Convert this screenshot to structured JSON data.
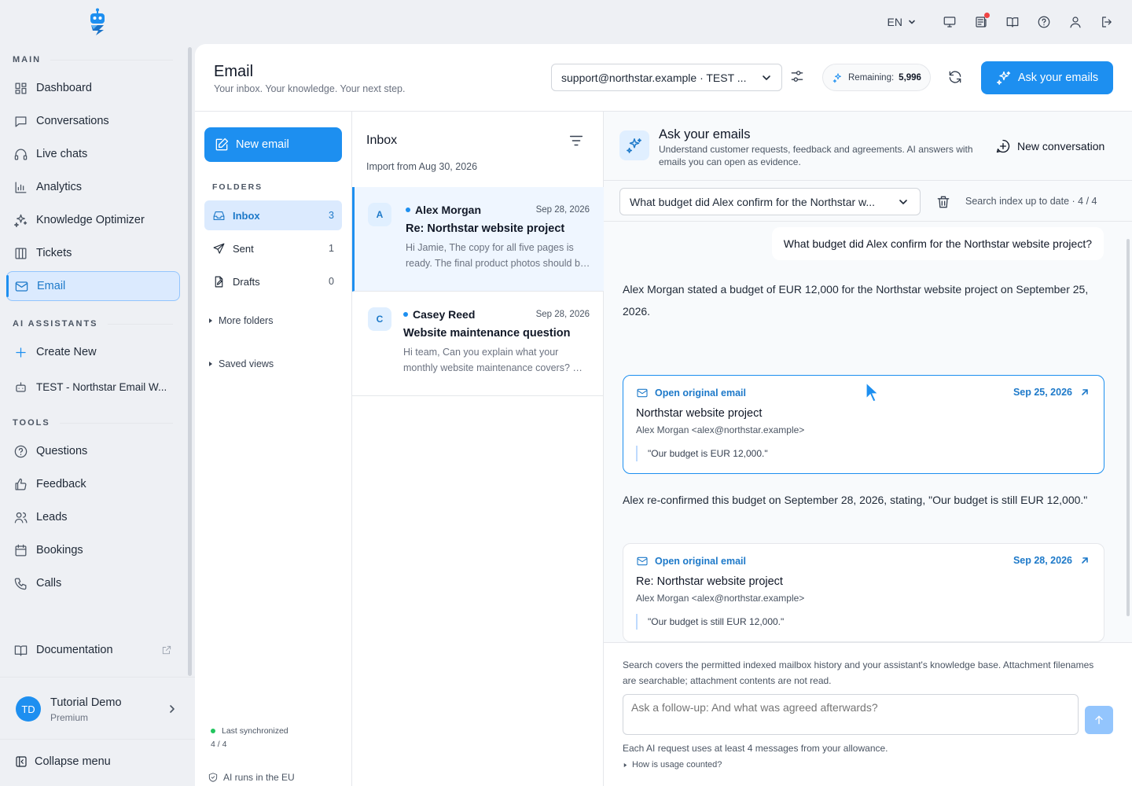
{
  "topbar": {
    "language": "EN",
    "icons": [
      "monitor-icon",
      "news-icon",
      "book-icon",
      "help-icon",
      "user-icon",
      "logout-icon"
    ]
  },
  "sidebar": {
    "sections": {
      "main": "MAIN",
      "ai": "AI ASSISTANTS",
      "tools": "TOOLS"
    },
    "main_items": [
      {
        "label": "Dashboard",
        "icon": "dashboard-icon"
      },
      {
        "label": "Conversations",
        "icon": "chat-icon"
      },
      {
        "label": "Live chats",
        "icon": "headset-icon"
      },
      {
        "label": "Analytics",
        "icon": "bar-chart-icon"
      },
      {
        "label": "Knowledge Optimizer",
        "icon": "sparkles-icon"
      },
      {
        "label": "Tickets",
        "icon": "columns-icon"
      },
      {
        "label": "Email",
        "icon": "mail-icon",
        "active": true
      }
    ],
    "ai_items": [
      {
        "label": "Create New",
        "icon": "plus-icon"
      },
      {
        "label": "TEST - Northstar Email W...",
        "icon": "bot-icon"
      }
    ],
    "tool_items": [
      {
        "label": "Questions",
        "icon": "question-icon"
      },
      {
        "label": "Feedback",
        "icon": "thumbs-up-icon"
      },
      {
        "label": "Leads",
        "icon": "users-icon"
      },
      {
        "label": "Bookings",
        "icon": "calendar-icon"
      },
      {
        "label": "Calls",
        "icon": "phone-icon"
      }
    ],
    "documentation": "Documentation",
    "profile": {
      "initials": "TD",
      "name": "Tutorial Demo",
      "plan": "Premium"
    },
    "collapse": "Collapse menu"
  },
  "header": {
    "title": "Email",
    "subtitle": "Your inbox. Your knowledge. Your next step.",
    "account": "support@northstar.example · TEST ...",
    "remaining_label": "Remaining:",
    "remaining_value": "5,996",
    "ask_button": "Ask your emails"
  },
  "folders": {
    "new_email": "New email",
    "label": "FOLDERS",
    "items": [
      {
        "label": "Inbox",
        "count": "3",
        "active": true
      },
      {
        "label": "Sent",
        "count": "1"
      },
      {
        "label": "Drafts",
        "count": "0"
      }
    ],
    "more": "More folders",
    "saved": "Saved views",
    "sync_label": "Last synchronized",
    "sync_count": "4 / 4",
    "eu": "AI runs in the EU"
  },
  "inbox": {
    "title": "Inbox",
    "import": "Import from Aug 30, 2026",
    "messages": [
      {
        "initial": "A",
        "from": "Alex Morgan",
        "date": "Sep 28, 2026",
        "subject": "Re: Northstar website project",
        "snippet": "Hi Jamie, The copy for all five pages is ready. The final product photos should be delivered next week."
      },
      {
        "initial": "C",
        "from": "Casey Reed",
        "date": "Sep 28, 2026",
        "subject": "Website maintenance question",
        "snippet": "Hi team, Can you explain what your monthly website maintenance covers? We would like to know more."
      }
    ]
  },
  "ask": {
    "title": "Ask your emails",
    "description": "Understand customer requests, feedback and agreements. AI answers with emails you can open as evidence.",
    "new_conversation": "New conversation",
    "question_select": "What budget did Alex confirm for the Northstar w...",
    "index_status": "Search index up to date · 4 / 4",
    "user_question": "What budget did Alex confirm for the Northstar website project?",
    "answer_1": "Alex Morgan stated a budget of EUR 12,000 for the Northstar website project on September 25, 2026.",
    "answer_2": "Alex re-confirmed this budget on September 28, 2026, stating, \"Our budget is still EUR 12,000.\"",
    "evidence": [
      {
        "open": "Open original email",
        "date": "Sep 25, 2026",
        "subject": "Northstar website project",
        "from": "Alex Morgan <alex@northstar.example>",
        "quote": "\"Our budget is EUR 12,000.\""
      },
      {
        "open": "Open original email",
        "date": "Sep 28, 2026",
        "subject": "Re: Northstar website project",
        "from": "Alex Morgan <alex@northstar.example>",
        "quote": "\"Our budget is still EUR 12,000.\""
      }
    ],
    "footer_note": "Search covers the permitted indexed mailbox history and your assistant's knowledge base. Attachment filenames are searchable; attachment contents are not read.",
    "input_placeholder": "Ask a follow-up: And what was agreed afterwards?",
    "allowance": "Each AI request uses at least 4 messages from your allowance.",
    "how": "How is usage counted?"
  },
  "colors": {
    "accent": "#1d8ff0",
    "active_bg": "#dbeafe",
    "sync": "#22c55e",
    "notification": "#ef4444"
  }
}
